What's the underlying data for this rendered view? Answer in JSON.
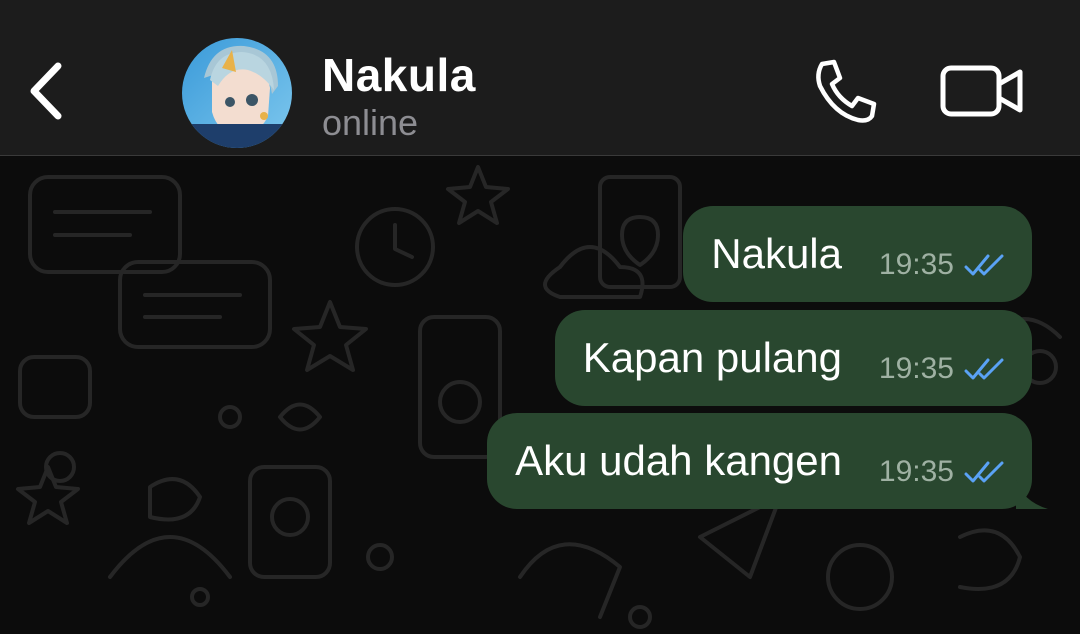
{
  "header": {
    "contact_name": "Nakula",
    "status": "online"
  },
  "messages": [
    {
      "text": "Nakula",
      "time": "19:35",
      "status": "read"
    },
    {
      "text": "Kapan pulang",
      "time": "19:35",
      "status": "read"
    },
    {
      "text": "Aku udah kangen",
      "time": "19:35",
      "status": "read"
    }
  ],
  "colors": {
    "header_bg": "#1c1c1c",
    "chat_bg": "#0c0c0c",
    "outgoing_bubble": "#29472f",
    "read_ticks": "#5aa2f5",
    "status_text": "#8d8d92"
  },
  "icons": [
    "chevron-left-icon",
    "phone-icon",
    "video-camera-icon",
    "double-check-icon"
  ]
}
